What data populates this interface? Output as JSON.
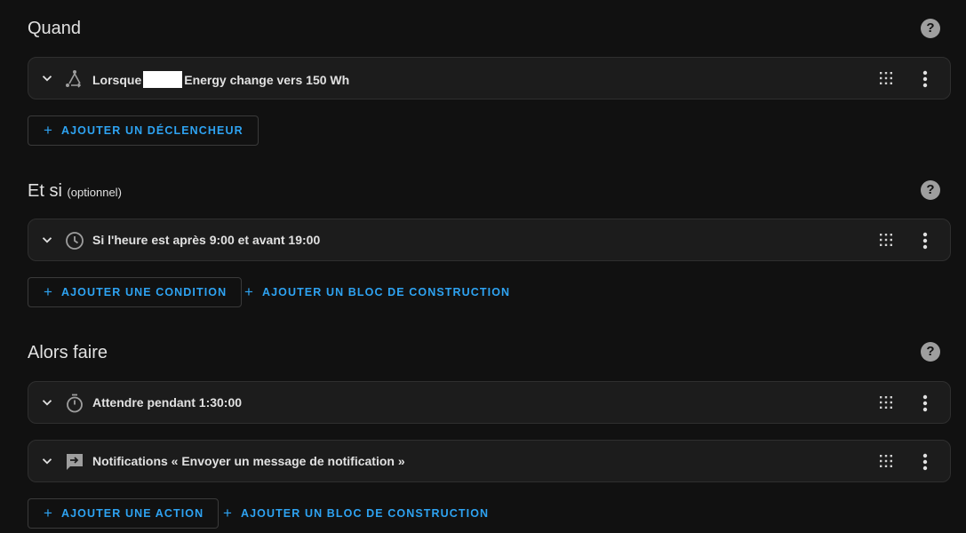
{
  "sections": {
    "when": {
      "title": "Quand",
      "help_icon": "help-circle-icon",
      "triggers": [
        {
          "prefix": "Lorsque",
          "suffix": "Energy change vers 150 Wh",
          "icon": "state-change-icon"
        }
      ],
      "add_trigger_label": "AJOUTER UN DÉCLENCHEUR"
    },
    "and_if": {
      "title": "Et si",
      "optional_label": "(optionnel)",
      "conditions": [
        {
          "label": "Si l'heure est après 9:00 et avant 19:00",
          "icon": "clock-icon"
        }
      ],
      "add_condition_label": "AJOUTER UNE CONDITION",
      "add_block_label": "AJOUTER UN BLOC DE CONSTRUCTION"
    },
    "then_do": {
      "title": "Alors faire",
      "actions": [
        {
          "label": "Attendre pendant 1:30:00",
          "icon": "timer-icon"
        },
        {
          "label": "Notifications « Envoyer un message de notification »",
          "icon": "message-arrow-icon"
        }
      ],
      "add_action_label": "AJOUTER UNE ACTION",
      "add_block_label": "AJOUTER UN BLOC DE CONSTRUCTION"
    }
  },
  "colors": {
    "accent": "#2ea3f2",
    "background": "#111111",
    "card": "#1c1c1c"
  }
}
